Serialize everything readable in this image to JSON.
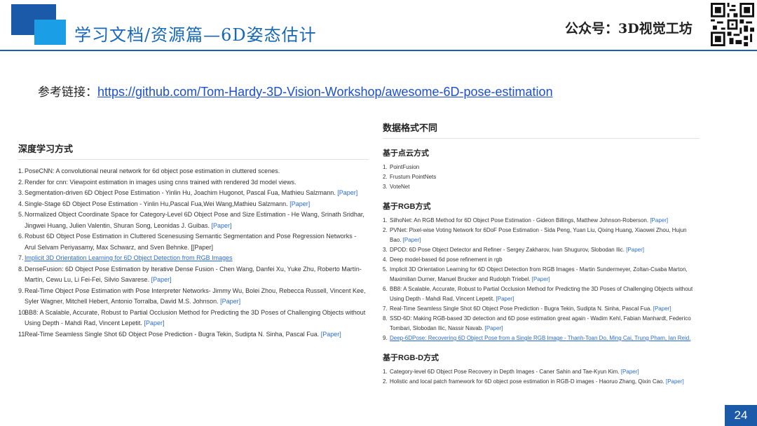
{
  "header": {
    "title": "学习文档/资源篇—6D姿态估计",
    "brand": "公众号：3D视觉工坊",
    "page_number": "24"
  },
  "reference": {
    "label": "参考链接：",
    "url": "https://github.com/Tom-Hardy-3D-Vision-Workshop/awesome-6D-pose-estimation"
  },
  "left": {
    "heading": "深度学习方式",
    "items": [
      {
        "n": "1.",
        "text": "PoseCNN: A convolutional neural network for 6d object pose estimation in cluttered scenes.",
        "link": ""
      },
      {
        "n": "2.",
        "text": "Render for cnn: Viewpoint estimation in images using cnns trained with rendered 3d model views.",
        "link": ""
      },
      {
        "n": "3.",
        "text": "Segmentation-driven 6D Object Pose Estimation - Yinlin Hu, Joachim Hugonot, Pascal Fua, Mathieu Salzmann.",
        "link": "[Paper]"
      },
      {
        "n": "4.",
        "text": "Single-Stage 6D Object Pose Estimation - Yinlin Hu,Pascal Fua,Wei Wang,Mathieu Salzmann.",
        "link": "[Paper]"
      },
      {
        "n": "5.",
        "text": "Normalized Object Coordinate Space for Category-Level 6D Object Pose and Size Estimation - He Wang, Srinath Sridhar, Jingwei Huang, Julien Valentin, Shuran Song, Leonidas J. Guibas.",
        "link": "[Paper]"
      },
      {
        "n": "6.",
        "text": "Robust 6D Object Pose Estimation in Cluttered Scenesusing Semantic Segmentation and Pose Regression Networks - Arul Selvam Periyasamy, Max Schwarz, and Sven Behnke. [[Paper]",
        "link": ""
      },
      {
        "n": "7.",
        "text": "",
        "link": "Implicit 3D Orientation Learning for 6D Object Detection from RGB Images"
      },
      {
        "n": "8.",
        "text": "DenseFusion: 6D Object Pose Estimation by Iterative Dense Fusion - Chen Wang, Danfei Xu, Yuke Zhu, Roberto Martín-Martín, Cewu Lu, Li Fei-Fei, Silvio Savarese.",
        "link": "[Paper]"
      },
      {
        "n": "9.",
        "text": "Real-Time Object Pose Estimation with Pose Interpreter Networks- Jimmy Wu, Bolei Zhou, Rebecca Russell, Vincent Kee, Syler Wagner, Mitchell Hebert, Antonio Torralba, David M.S. Johnson.",
        "link": "[Paper]"
      },
      {
        "n": "10.",
        "text": "BB8: A Scalable, Accurate, Robust to Partial Occlusion Method for Predicting the 3D Poses of Challenging Objects without Using Depth - Mahdi Rad, Vincent Lepetit.",
        "link": "[Paper]"
      },
      {
        "n": "11.",
        "text": "Real-Time Seamless Single Shot 6D Object Pose Prediction - Bugra Tekin, Sudipta N. Sinha, Pascal Fua.",
        "link": "[Paper]"
      }
    ]
  },
  "right": {
    "heading": "数据格式不同",
    "sections": [
      {
        "title": "基于点云方式",
        "items": [
          {
            "n": "1.",
            "text": "PointFusion",
            "link": ""
          },
          {
            "n": "2.",
            "text": "Frustum PointNets",
            "link": ""
          },
          {
            "n": "3.",
            "text": "VoteNet",
            "link": ""
          }
        ]
      },
      {
        "title": "基于RGB方式",
        "items": [
          {
            "n": "1.",
            "text": "SilhoNet: An RGB Method for 6D Object Pose Estimation - Gideon Billings, Matthew Johnson-Roberson.",
            "link": "[Paper]"
          },
          {
            "n": "2.",
            "text": "PVNet: Pixel-wise Voting Network for 6DoF Pose Estimation - Sida Peng, Yuan Liu, Qixing Huang, Xiaowei Zhou, Hujun Bao.",
            "link": "[Paper]"
          },
          {
            "n": "3.",
            "text": "DPOD: 6D Pose Object Detector and Refiner - Sergey Zakharov, Ivan Shugurov, Slobodan Ilic.",
            "link": "[Paper]"
          },
          {
            "n": "4.",
            "text": "Deep model-based 6d pose refinement in rgb",
            "link": ""
          },
          {
            "n": "5.",
            "text": "Implicit 3D Orientation Learning for 6D Object Detection from RGB Images - Martin Sundermeyer, Zoltan-Csaba Marton, Maximilian Durner, Manuel Brucker and Rudolph Triebel.",
            "link": "[Paper]"
          },
          {
            "n": "6.",
            "text": "BB8: A Scalable, Accurate, Robust to Partial Occlusion Method for Predicting the 3D Poses of Challenging Objects without Using Depth - Mahdi Rad, Vincent Lepetit.",
            "link": "[Paper]"
          },
          {
            "n": "7.",
            "text": "Real-Time Seamless Single Shot 6D Object Pose Prediction - Bugra Tekin, Sudipta N. Sinha, Pascal Fua.",
            "link": "[Paper]"
          },
          {
            "n": "8.",
            "text": "SSD-6D: Making RGB-based 3D detection and 6D pose estimation great again - Wadim Kehl, Fabian Manhardt, Federico Tombari, Slobodan Ilic, Nassir Navab.",
            "link": "[Paper]"
          },
          {
            "n": "9.",
            "text": "",
            "link": "Deep-6DPose: Recovering 6D Object Pose from a Single RGB Image - Thanh-Toan Do, Ming Cai, Trung Pham, Ian Reid."
          }
        ]
      },
      {
        "title": "基于RGB-D方式",
        "items": [
          {
            "n": "1.",
            "text": "Category-level 6D Object Pose Recovery in Depth Images - Caner Sahin and Tae-Kyun Kim.",
            "link": "[Paper]"
          },
          {
            "n": "2.",
            "text": "Holistic and local patch framework for 6D object pose estimation in RGB-D images - Haoruo Zhang, Qixin Cao.",
            "link": "[Paper]"
          }
        ]
      }
    ]
  }
}
